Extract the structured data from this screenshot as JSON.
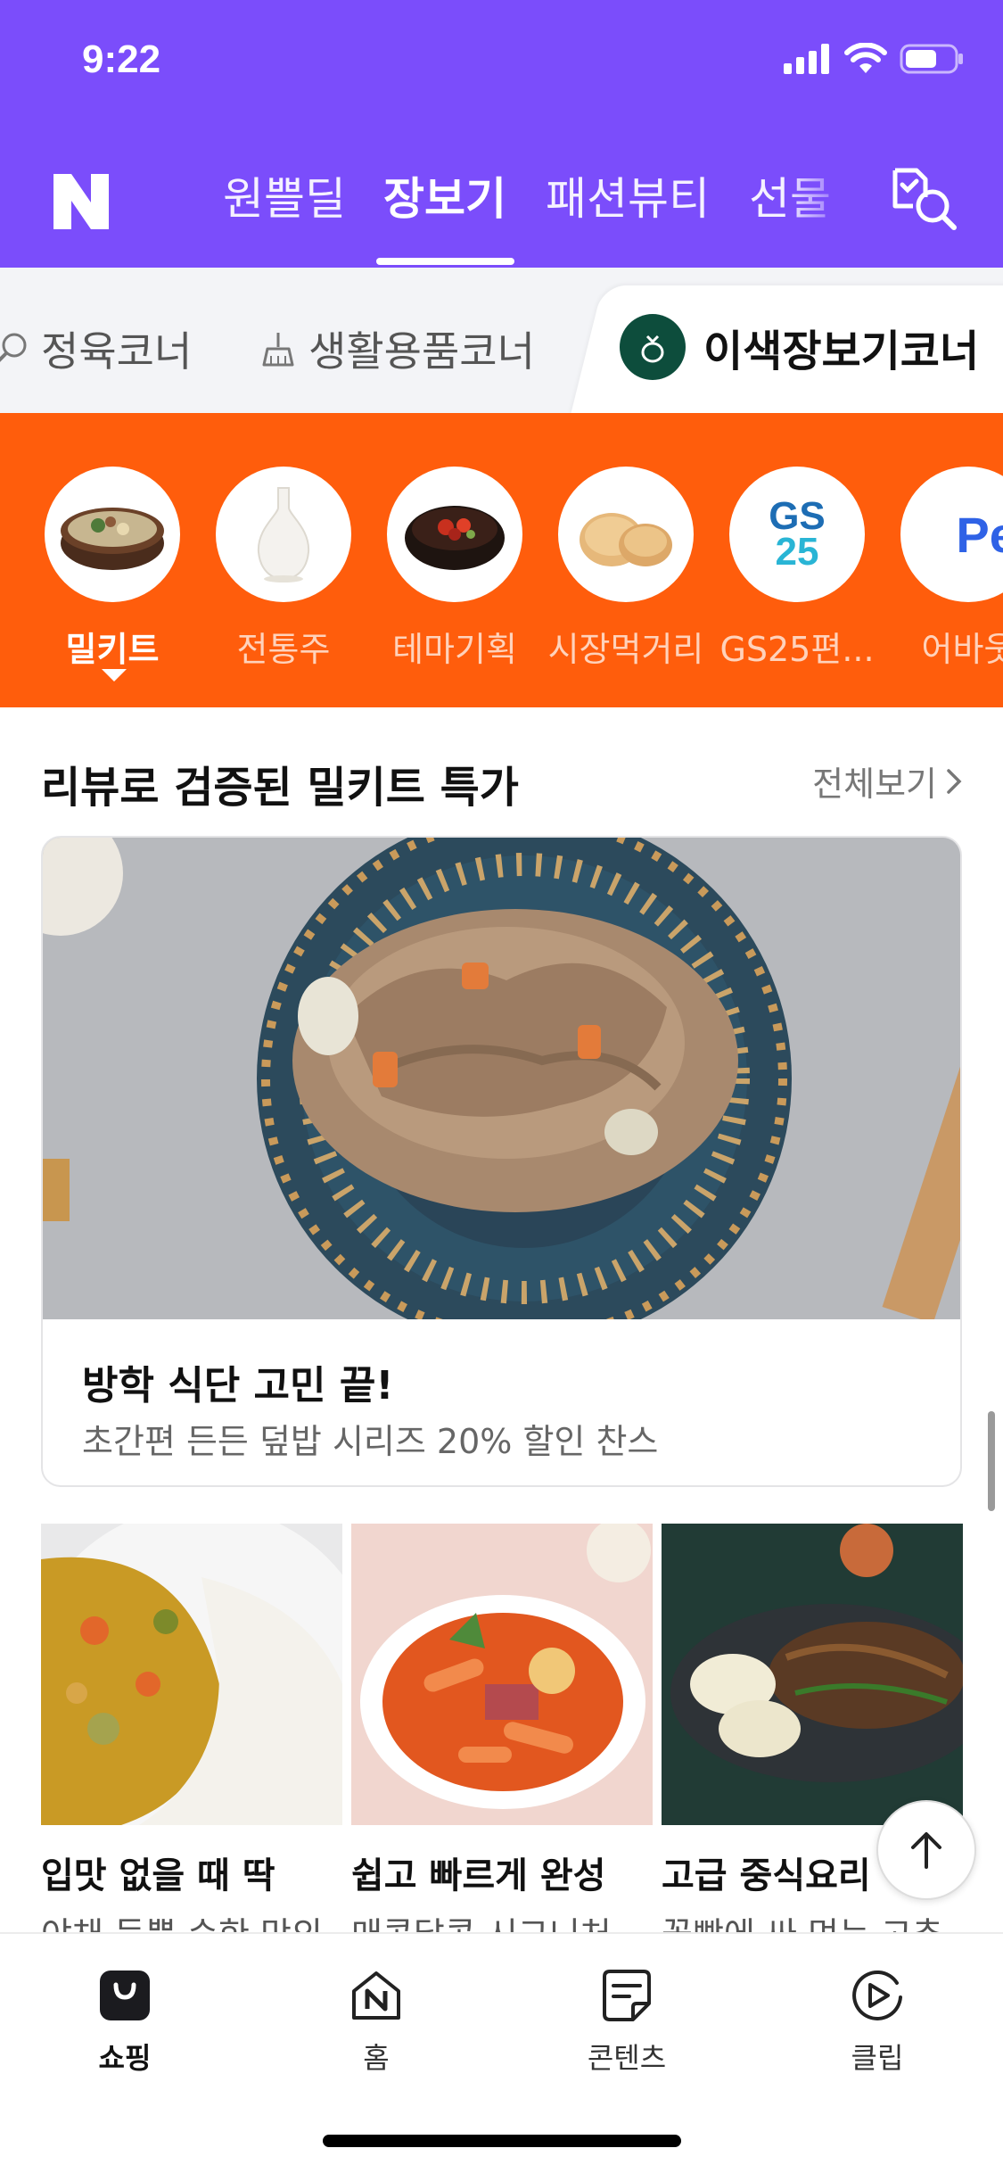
{
  "status_bar": {
    "time": "9:22"
  },
  "header": {
    "tabs": [
      {
        "label": "원쁠딜",
        "active": false
      },
      {
        "label": "장보기",
        "active": true
      },
      {
        "label": "패션뷰티",
        "active": false
      },
      {
        "label": "선물",
        "active": false
      }
    ]
  },
  "corners": {
    "items": [
      {
        "label": "정육코너",
        "icon": "meat-icon"
      },
      {
        "label": "생활용품코너",
        "icon": "broom-icon"
      }
    ],
    "active": {
      "label": "이색장보기코너",
      "icon": "pouch-icon"
    }
  },
  "categories": [
    {
      "label": "밀키트",
      "active": true
    },
    {
      "label": "전통주",
      "active": false
    },
    {
      "label": "테마기획",
      "active": false
    },
    {
      "label": "시장먹거리",
      "active": false
    },
    {
      "label": "GS25편...",
      "active": false,
      "logo_text_1": "GS",
      "logo_text_2": "25"
    },
    {
      "label": "어바웃",
      "active": false,
      "logo_text": "Pet"
    }
  ],
  "section": {
    "title": "리뷰로 검증된 밀키트 특가",
    "see_all": "전체보기"
  },
  "hero": {
    "title": "방학 식단 고민 끝!",
    "subtitle": "초간편 든든 덮밥 시리즈 20% 할인 찬스"
  },
  "products": [
    {
      "title": "입맛 없을 때 딱",
      "subtitle": "야채 듬뿍 순한 맛의"
    },
    {
      "title": "쉽고 빠르게 완성",
      "subtitle": "매콤달콤 시그니처"
    },
    {
      "title": "고급 중식요리",
      "subtitle": "꽃빵에 싸 먹는 고추"
    }
  ],
  "bottom_nav": [
    {
      "label": "쇼핑",
      "active": true
    },
    {
      "label": "홈",
      "active": false
    },
    {
      "label": "콘텐츠",
      "active": false
    },
    {
      "label": "클립",
      "active": false
    }
  ],
  "colors": {
    "header": "#7b4dfb",
    "category_bar": "#ff5d0c",
    "corner_badge": "#0d4d3c"
  }
}
